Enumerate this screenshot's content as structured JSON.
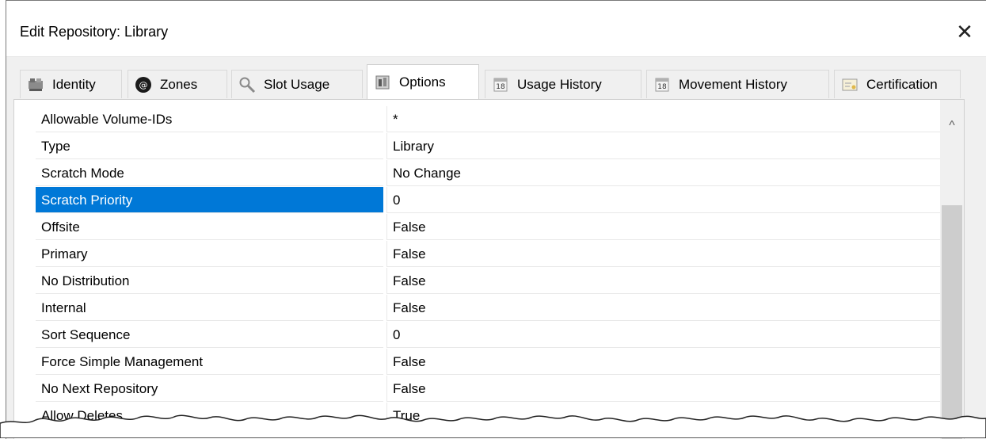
{
  "dialog": {
    "title": "Edit Repository: Library",
    "close_glyph": "✕"
  },
  "tabs": [
    {
      "label": "Identity",
      "icon": "identity-icon",
      "active": false
    },
    {
      "label": "Zones",
      "icon": "zones-icon",
      "active": false
    },
    {
      "label": "Slot Usage",
      "icon": "magnifier-icon",
      "active": false
    },
    {
      "label": "Options",
      "icon": "options-icon",
      "active": true
    },
    {
      "label": "Usage History",
      "icon": "calendar-icon",
      "active": false
    },
    {
      "label": "Movement History",
      "icon": "calendar-icon",
      "active": false
    },
    {
      "label": "Certification",
      "icon": "certificate-icon",
      "active": false
    }
  ],
  "properties": [
    {
      "name": "Allowable Volume-IDs",
      "value": "*"
    },
    {
      "name": "Type",
      "value": "Library"
    },
    {
      "name": "Scratch Mode",
      "value": "No Change"
    },
    {
      "name": "Scratch Priority",
      "value": "0",
      "selected": true
    },
    {
      "name": "Offsite",
      "value": "False"
    },
    {
      "name": "Primary",
      "value": "False"
    },
    {
      "name": "No Distribution",
      "value": "False"
    },
    {
      "name": "Internal",
      "value": "False"
    },
    {
      "name": "Sort Sequence",
      "value": "0"
    },
    {
      "name": "Force Simple Management",
      "value": "False"
    },
    {
      "name": "No Next Repository",
      "value": "False"
    },
    {
      "name": "Allow Deletes",
      "value": "True"
    }
  ],
  "scrollbar": {
    "up_glyph": "^"
  },
  "colors": {
    "selection": "#0078d7",
    "dialog_bg": "#f0f0f0"
  }
}
